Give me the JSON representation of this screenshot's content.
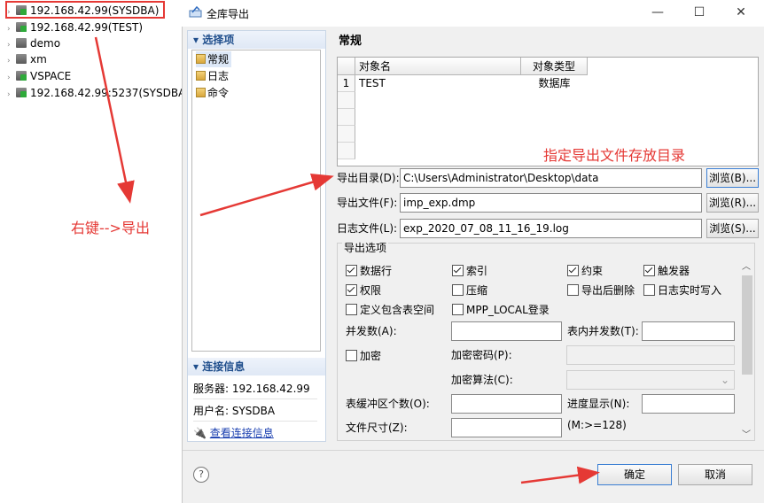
{
  "tree": {
    "items": [
      {
        "label": "192.168.42.99(SYSDBA)",
        "icon": "database-connected-icon"
      },
      {
        "label": "192.168.42.99(TEST)",
        "icon": "database-connected-icon"
      },
      {
        "label": "demo",
        "icon": "database-icon"
      },
      {
        "label": "xm",
        "icon": "database-icon"
      },
      {
        "label": "VSPACE",
        "icon": "database-connected-icon"
      },
      {
        "label": "192.168.42.99:5237(SYSDBA",
        "icon": "database-connected-icon"
      }
    ]
  },
  "dialog": {
    "title": "全库导出",
    "window_buttons": {
      "minimize": "—",
      "maximize": "☐",
      "close": "✕"
    }
  },
  "nav": {
    "section_title": "▾ 选择项",
    "items": [
      "常规",
      "日志",
      "命令"
    ],
    "conn_section_title": "▾ 连接信息",
    "server": "服务器: 192.168.42.99",
    "user": "用户名: SYSDBA",
    "view_link": "查看连接信息"
  },
  "general": {
    "title": "常规",
    "table": {
      "columns": [
        "对象名",
        "对象类型"
      ],
      "rows": [
        [
          "1",
          "TEST",
          "数据库"
        ]
      ]
    },
    "export_dir_label": "导出目录(D):",
    "export_dir_value": "C:\\Users\\Administrator\\Desktop\\data",
    "browse_b": "浏览(B)...",
    "export_file_label": "导出文件(F):",
    "export_file_value": "imp_exp.dmp",
    "browse_r": "浏览(R)...",
    "log_file_label": "日志文件(L):",
    "log_file_value": "exp_2020_07_08_11_16_19.log",
    "browse_s": "浏览(S)..."
  },
  "options": {
    "title": "导出选项",
    "checks": [
      {
        "label": "数据行",
        "checked": true
      },
      {
        "label": "索引",
        "checked": true
      },
      {
        "label": "约束",
        "checked": true
      },
      {
        "label": "触发器",
        "checked": true
      },
      {
        "label": "权限",
        "checked": true
      },
      {
        "label": "压缩",
        "checked": false
      },
      {
        "label": "导出后删除",
        "checked": false
      },
      {
        "label": "日志实时写入",
        "checked": false
      },
      {
        "label": "定义包含表空间",
        "checked": false
      },
      {
        "label": "MPP_LOCAL登录",
        "checked": false
      }
    ],
    "parallel_label": "并发数(A):",
    "table_parallel_label": "表内并发数(T):",
    "encrypt_label": "加密",
    "encrypt_pwd_label": "加密密码(P):",
    "encrypt_alg_label": "加密算法(C):",
    "buffer_label": "表缓冲区个数(O):",
    "progress_label": "进度显示(N):",
    "file_size_label": "文件尺寸(Z):",
    "file_size_hint": "(M:>=128)"
  },
  "footer": {
    "help": "?",
    "ok": "确定",
    "cancel": "取消"
  },
  "annotations": {
    "right_click_export": "右键-->导出",
    "specify_dir": "指定导出文件存放目录",
    "color": "#e53935"
  }
}
